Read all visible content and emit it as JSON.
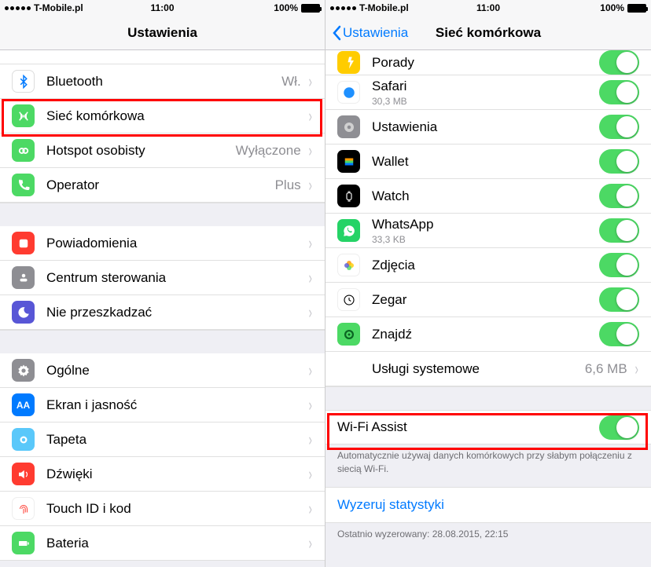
{
  "statusbar": {
    "carrier": "T-Mobile.pl",
    "time": "11:00",
    "battery": "100%"
  },
  "left": {
    "title": "Ustawienia",
    "rows": [
      {
        "label": "Bluetooth",
        "value": "Wł.",
        "icon": "bluetooth"
      },
      {
        "label": "Sieć komórkowa",
        "icon": "cellular"
      },
      {
        "label": "Hotspot osobisty",
        "value": "Wyłączone",
        "icon": "hotspot"
      },
      {
        "label": "Operator",
        "value": "Plus",
        "icon": "operator"
      }
    ],
    "group2": [
      {
        "label": "Powiadomienia",
        "icon": "notifications"
      },
      {
        "label": "Centrum sterowania",
        "icon": "controlcenter"
      },
      {
        "label": "Nie przeszkadzać",
        "icon": "dnd"
      }
    ],
    "group3": [
      {
        "label": "Ogólne",
        "icon": "general"
      },
      {
        "label": "Ekran i jasność",
        "icon": "display"
      },
      {
        "label": "Tapeta",
        "icon": "wallpaper"
      },
      {
        "label": "Dźwięki",
        "icon": "sounds"
      },
      {
        "label": "Touch ID i kod",
        "icon": "touchid"
      },
      {
        "label": "Bateria",
        "icon": "battery"
      }
    ]
  },
  "right": {
    "back": "Ustawienia",
    "title": "Sieć komórkowa",
    "apps": [
      {
        "label": "Porady",
        "icon": "tips"
      },
      {
        "label": "Safari",
        "sub": "30,3 MB",
        "icon": "safari"
      },
      {
        "label": "Ustawienia",
        "icon": "settings"
      },
      {
        "label": "Wallet",
        "icon": "wallet"
      },
      {
        "label": "Watch",
        "icon": "watch"
      },
      {
        "label": "WhatsApp",
        "sub": "33,3 KB",
        "icon": "whatsapp"
      },
      {
        "label": "Zdjęcia",
        "icon": "photos"
      },
      {
        "label": "Zegar",
        "icon": "clock"
      },
      {
        "label": "Znajdź",
        "icon": "find"
      }
    ],
    "system_services": {
      "label": "Usługi systemowe",
      "value": "6,6 MB"
    },
    "wifi_assist": {
      "label": "Wi-Fi Assist"
    },
    "wifi_assist_desc": "Automatycznie używaj danych komórkowych przy słabym połączeniu z siecią Wi-Fi.",
    "reset": "Wyzeruj statystyki",
    "reset_desc": "Ostatnio wyzerowany: 28.08.2015, 22:15"
  }
}
